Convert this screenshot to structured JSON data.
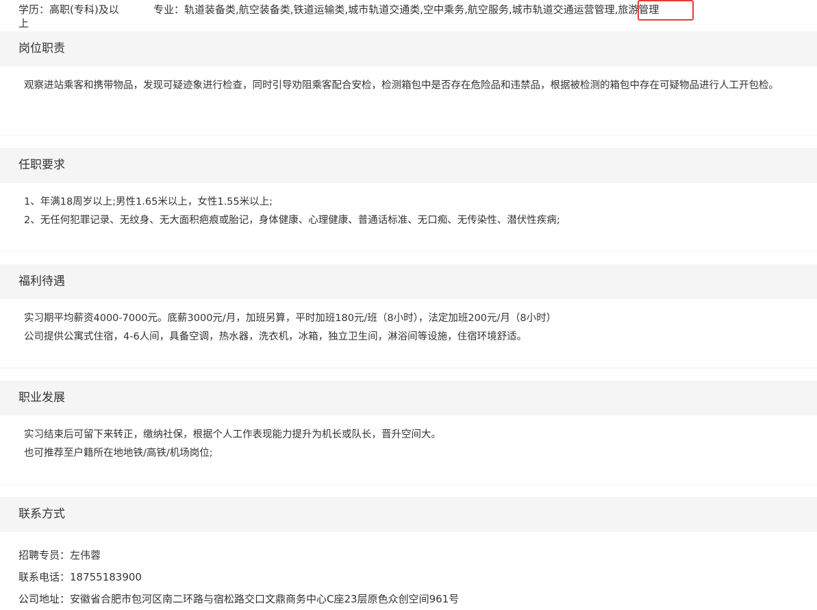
{
  "top": {
    "education_line1": "学历：高职(专科)及以",
    "education_line2": "上",
    "major": "专业：轨道装备类,航空装备类,铁道运输类,城市轨道交通类,空中乘务,航空服务,城市轨道交通运营管理,旅游管理",
    "highlight_color": "#e53935"
  },
  "sections": [
    {
      "title": "岗位职责",
      "lines": [
        "观察进站乘客和携带物品，发现可疑迹象进行检查，同时引导劝阻乘客配合安检，检测箱包中是否存在危险品和违禁品，根据被检测的箱包中存在可疑物品进行人工开包检。"
      ]
    },
    {
      "title": "任职要求",
      "lines": [
        "1、年满18周岁以上;男性1.65米以上，女性1.55米以上;",
        "2、无任何犯罪记录、无纹身、无大面积疤痕或胎记，身体健康、心理健康、普通话标准、无口痴、无传染性、潜伏性疾病;"
      ]
    },
    {
      "title": "福利待遇",
      "lines": [
        "实习期平均薪资4000-7000元。底薪3000元/月，加班另算，平时加班180元/班（8小时），法定加班200元/月（8小时）",
        "公司提供公寓式住宿，4-6人间，具备空调，热水器，洗衣机，冰箱，独立卫生间，淋浴间等设施，住宿环境舒适。"
      ]
    },
    {
      "title": "职业发展",
      "lines": [
        "实习结束后可留下来转正，缴纳社保，根据个人工作表现能力提升为机长或队长，晋升空间大。",
        "也可推荐至户籍所在地地铁/高铁/机场岗位;"
      ]
    },
    {
      "title": "联系方式"
    }
  ],
  "contact": {
    "recruiter": "招聘专员：左伟蓉",
    "phone": "联系电话：18755183900",
    "address": "公司地址：安徽省合肥市包河区南二环路与宿松路交口文鼎商务中心C座23层原色众创空间961号"
  }
}
